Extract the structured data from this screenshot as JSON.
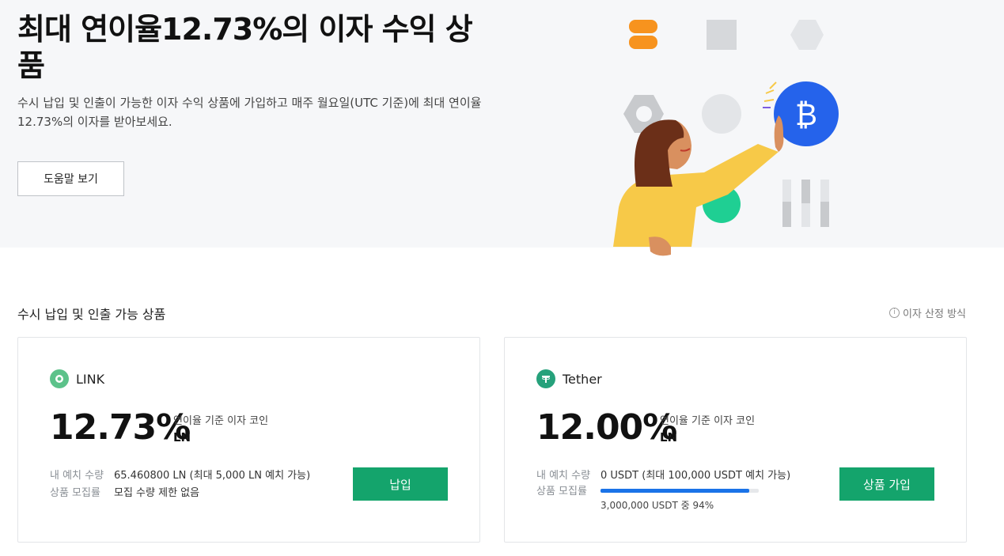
{
  "hero": {
    "title": "최대 연이율12.73%의 이자 수익 상품",
    "description": "수시 납입 및 인출이 가능한 이자 수익 상품에 가입하고 매주 월요일(UTC 기준)에 최대 연이율12.73%의 이자를 받아보세요.",
    "help_button": "도움말 보기"
  },
  "section": {
    "title": "수시 납입 및 인출 가능 상품",
    "calc_link": "이자 산정 방식",
    "info_icon": "info-icon"
  },
  "products": [
    {
      "coin": "LINK",
      "icon": "link-coin-icon",
      "icon_color": "#5cc28a",
      "rate": "12.73%",
      "rate_label": "연이율 기준 이자 코인",
      "unit": "LN",
      "deposit_key": "내 예치 수량",
      "deposit_value": "65.460800 LN (최대 5,000 LN 예치 가능)",
      "recruit_key": "상품 모집률",
      "recruit_value": "모집 수량 제한 없음",
      "button": "납입"
    },
    {
      "coin": "Tether",
      "icon": "tether-coin-icon",
      "icon_color": "#26a17b",
      "rate": "12.00%",
      "rate_label": "연이율 기준 이자 코인",
      "unit": "LN",
      "deposit_key": "내 예치 수량",
      "deposit_value": "0 USDT (최대 100,000 USDT 예치 가능)",
      "recruit_key": "상품 모집률",
      "recruit_progress": 0.94,
      "recruit_text": "3,000,000 USDT 중 94%",
      "button": "상품 가입"
    }
  ],
  "colors": {
    "accent_green": "#14a46c",
    "progress_blue": "#1a73e8",
    "hero_bg": "#f6f7f9"
  }
}
